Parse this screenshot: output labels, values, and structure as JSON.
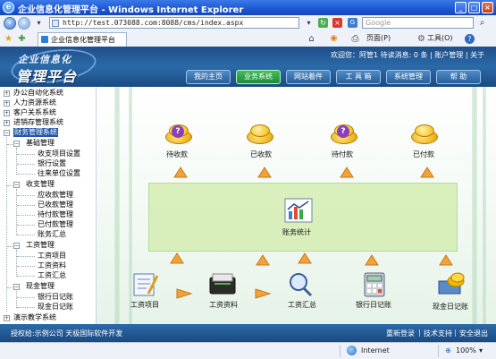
{
  "window": {
    "title": "企业信息化管理平台 - Windows Internet Explorer",
    "min": "_",
    "max": "□",
    "close": "×"
  },
  "address": {
    "url": "http://test.073088.com:8088/cms/index.aspx",
    "search_placeholder": "Google"
  },
  "tabbar": {
    "tab_title": "企业信息化管理平台",
    "page_menu": "页面(P)",
    "tools_menu": "工具(O)",
    "help_glyph": "?"
  },
  "header": {
    "logo_line1": "企业信息化",
    "logo_line2": "管理平台",
    "welcome": "欢迎您：阿管1 待读消息: 0 条 | 账户管理 | 关于",
    "nav": [
      {
        "label": "我的主页"
      },
      {
        "label": "业务系统"
      },
      {
        "label": "网站着件"
      },
      {
        "label": "工 具 箱"
      },
      {
        "label": "系统管理"
      },
      {
        "label": "帮  助"
      }
    ]
  },
  "sidebar": {
    "top_items": [
      {
        "label": "办公自动化系统"
      },
      {
        "label": "人力资源系统"
      },
      {
        "label": "客户关系系统"
      },
      {
        "label": "进销存管理系统"
      },
      {
        "label": "财务管理系统"
      }
    ],
    "finance": {
      "basic": {
        "label": "基础管理",
        "children": [
          "收支项目设置",
          "银行设置",
          "往来单位设置"
        ]
      },
      "income": {
        "label": "收支管理",
        "children": [
          "应收款管理",
          "已收款管理",
          "待付款管理",
          "已付款管理",
          "账务汇总"
        ]
      },
      "salary": {
        "label": "工资管理",
        "children": [
          "工资项目",
          "工资资料",
          "工资汇总"
        ]
      },
      "cash": {
        "label": "现金管理",
        "children": [
          "银行日记账",
          "现金日记账"
        ]
      }
    },
    "last_item": "演示教学系统"
  },
  "main": {
    "top_row": [
      "待收款",
      "已收款",
      "待付款",
      "已付款"
    ],
    "center": "账务统计",
    "bottom_row": [
      "工资项目",
      "工资资料",
      "工资汇总",
      "银行日记账",
      "现金日记账"
    ]
  },
  "footer": {
    "left": "授权给:示例公司  天极国际软件开发",
    "relogin": "重新登录",
    "support": "技术支持",
    "logout": "安全退出"
  },
  "statusbar": {
    "zone": "Internet",
    "zoom": "100%"
  },
  "colors": {
    "titlebar": "#1c56d3",
    "header": "#2b6aa8",
    "active_nav": "#1f8a3a",
    "panel": "#d8efb9",
    "selected": "#2357a8"
  }
}
